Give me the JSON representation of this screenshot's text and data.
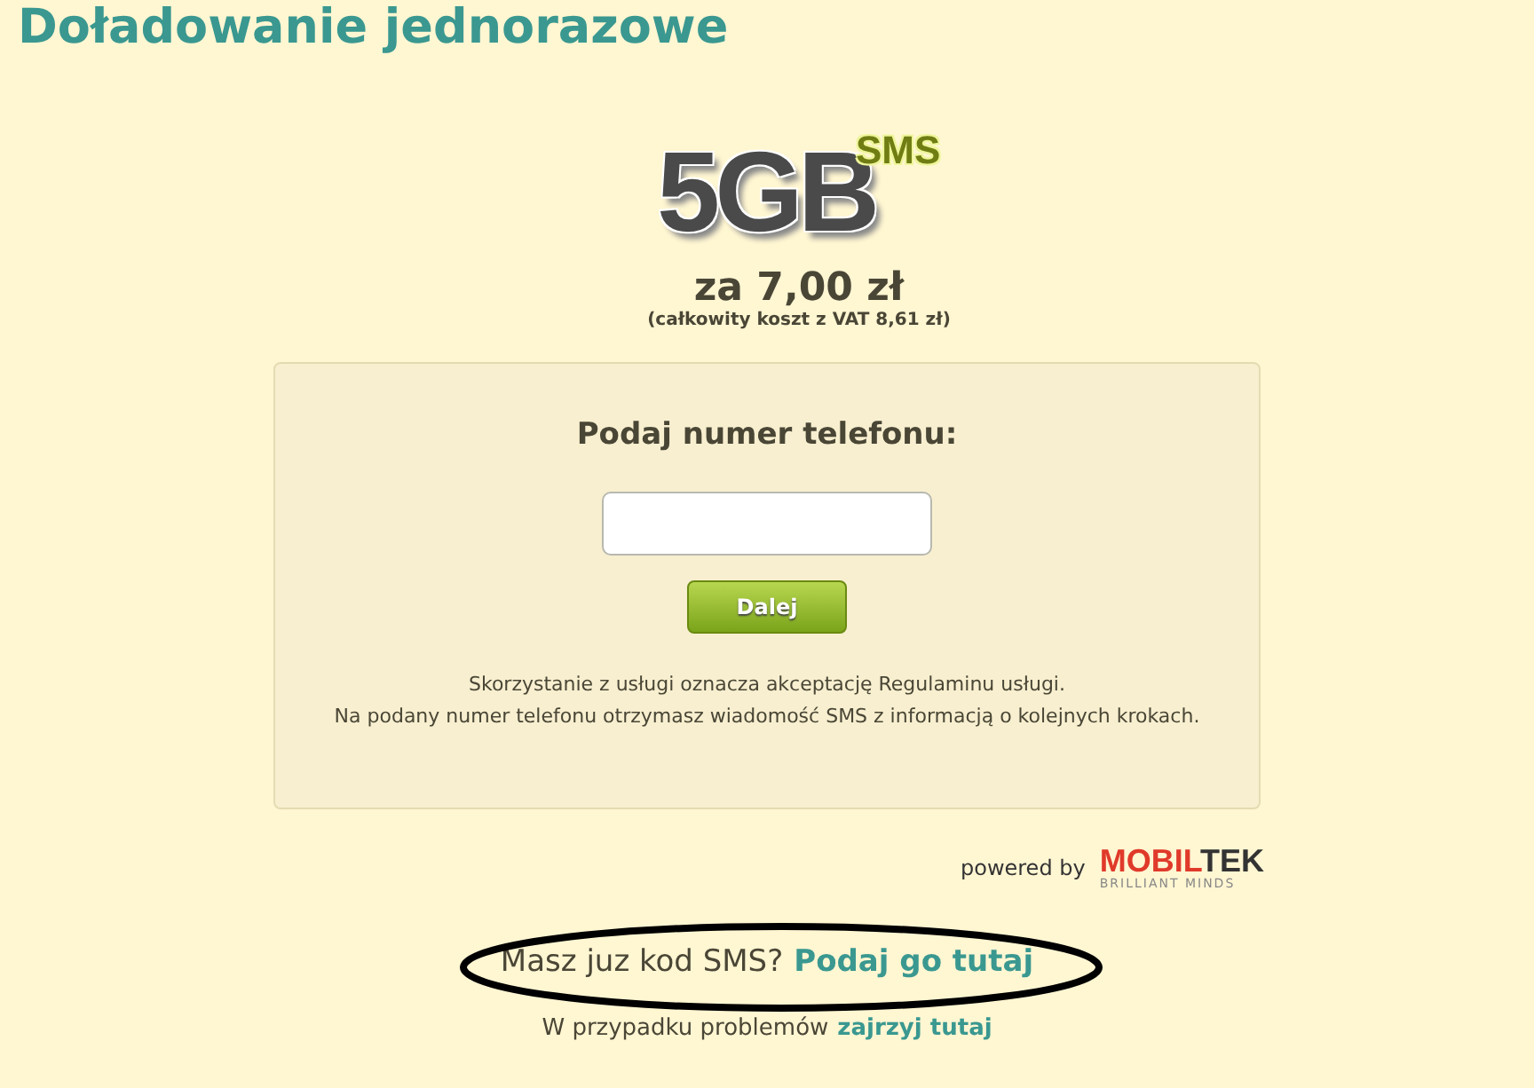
{
  "title": "Doładowanie jednorazowe",
  "offer": {
    "amount": "5GB",
    "badge": "SMS",
    "price": "za 7,00 zł",
    "vat_note": "(całkowity koszt z VAT 8,61 zł)"
  },
  "form": {
    "label": "Podaj numer telefonu:",
    "button": "Dalej",
    "notes": [
      "Skorzystanie z usługi oznacza akceptację Regulaminu usługi.",
      "Na podany numer telefonu otrzymasz wiadomość SMS z informacją o kolejnych krokach."
    ]
  },
  "powered": {
    "label": "powered by",
    "brand_red": "MOBIL",
    "brand_dark": "TEK",
    "tagline": "BRILLIANT MINDS"
  },
  "code_prompt": {
    "text": "Masz juz kod SMS?",
    "link": "Podaj go tutaj"
  },
  "help": {
    "text": "W przypadku problemów",
    "link": "zajrzyj tutaj"
  }
}
